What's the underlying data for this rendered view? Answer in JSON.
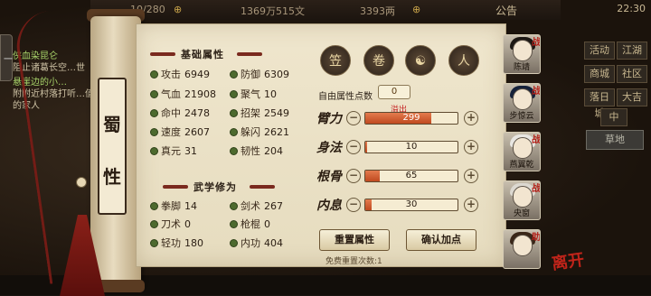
{
  "top_bar": {
    "stamina": "10/280",
    "silver": "1369万515文",
    "gold": "3393两",
    "notice_label": "公告",
    "clock": "22:30"
  },
  "left_tab_label": "一",
  "quests": [
    {
      "title": "侠血染昆仑",
      "desc": "阻止诸葛长空…世"
    },
    {
      "title": "悬崖边的小…",
      "desc": "附附近村落打听…值的家人"
    }
  ],
  "right_menu": {
    "buttons": [
      "活动",
      "江湖",
      "商城",
      "社区",
      "落日城",
      "大吉",
      "中"
    ],
    "ground": "草地"
  },
  "sect": {
    "chars": [
      "蜀",
      "性"
    ]
  },
  "basic": {
    "title": "基础属性",
    "items": [
      {
        "label": "攻击",
        "value": "6949"
      },
      {
        "label": "防御",
        "value": "6309"
      },
      {
        "label": "气血",
        "value": "21908"
      },
      {
        "label": "聚气",
        "value": "10"
      },
      {
        "label": "命中",
        "value": "2478"
      },
      {
        "label": "招架",
        "value": "2549"
      },
      {
        "label": "速度",
        "value": "2607"
      },
      {
        "label": "躲闪",
        "value": "2621"
      },
      {
        "label": "真元",
        "value": "31"
      },
      {
        "label": "韧性",
        "value": "204"
      }
    ]
  },
  "martial": {
    "title": "武学修为",
    "items": [
      {
        "label": "拳脚",
        "value": "14"
      },
      {
        "label": "剑术",
        "value": "267"
      },
      {
        "label": "刀术",
        "value": "0"
      },
      {
        "label": "枪棍",
        "value": "0"
      },
      {
        "label": "轻功",
        "value": "180"
      },
      {
        "label": "内功",
        "value": "404"
      }
    ]
  },
  "tabs": [
    {
      "icon": "hat-icon",
      "glyph": "笠"
    },
    {
      "icon": "scroll-icon",
      "glyph": "卷"
    },
    {
      "icon": "taiji-icon",
      "glyph": "☯"
    },
    {
      "icon": "figure-icon",
      "glyph": "人"
    }
  ],
  "allocation": {
    "free_label": "自由属性点数",
    "free_value": "0",
    "overflow_label": "溢出",
    "rows": [
      {
        "label": "臂力",
        "value": "299",
        "fill_pct": 72,
        "over": true
      },
      {
        "label": "身法",
        "value": "10",
        "fill_pct": 2,
        "over": false
      },
      {
        "label": "根骨",
        "value": "65",
        "fill_pct": 16,
        "over": false
      },
      {
        "label": "内息",
        "value": "30",
        "fill_pct": 7,
        "over": false
      }
    ],
    "reset_btn": "重置属性",
    "confirm_btn": "确认加点",
    "free_reset": "免费重置次数:1"
  },
  "characters": [
    {
      "name": "陈靖",
      "badge": "战",
      "hair": "#1c1713"
    },
    {
      "name": "步惊云",
      "badge": "战",
      "hair": "#15213a"
    },
    {
      "name": "燕翼乾",
      "badge": "战",
      "hair": "#e8e6e2"
    },
    {
      "name": "央窗",
      "badge": "战",
      "hair": "#dcd8d0"
    },
    {
      "name": "",
      "badge": "助",
      "hair": "#3a2618"
    }
  ],
  "colors": {
    "accent": "#c04a1f",
    "parchment": "#efe6cd",
    "ink": "#2a1d12",
    "stamp": "#c0241a"
  },
  "stamp_text": "离开"
}
